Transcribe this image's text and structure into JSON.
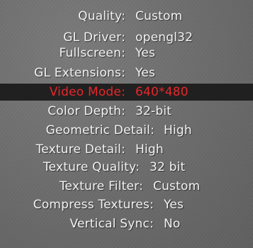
{
  "options": [
    {
      "label": "Quality:",
      "value": "Custom"
    },
    {
      "label": "GL Driver:",
      "value": "opengl32"
    },
    {
      "label": "Fullscreen:",
      "value": "Yes"
    },
    {
      "label": "GL Extensions:",
      "value": "Yes"
    },
    {
      "label": "Video Mode:",
      "value": "640*480",
      "selected": true
    },
    {
      "label": "Color Depth:",
      "value": "32-bit"
    },
    {
      "label": "Geometric Detail:",
      "value": "High"
    },
    {
      "label": "Texture Detail:",
      "value": "High"
    },
    {
      "label": "Texture Quality:",
      "value": "32 bit"
    },
    {
      "label": "Texture Filter:",
      "value": "Custom"
    },
    {
      "label": "Compress Textures:",
      "value": "Yes"
    },
    {
      "label": "Vertical Sync:",
      "value": "No"
    }
  ],
  "colors": {
    "text": "#f2f2f2",
    "selected_text": "#e8262a",
    "selected_bar": "#202020",
    "background": "#6f6f6f"
  }
}
